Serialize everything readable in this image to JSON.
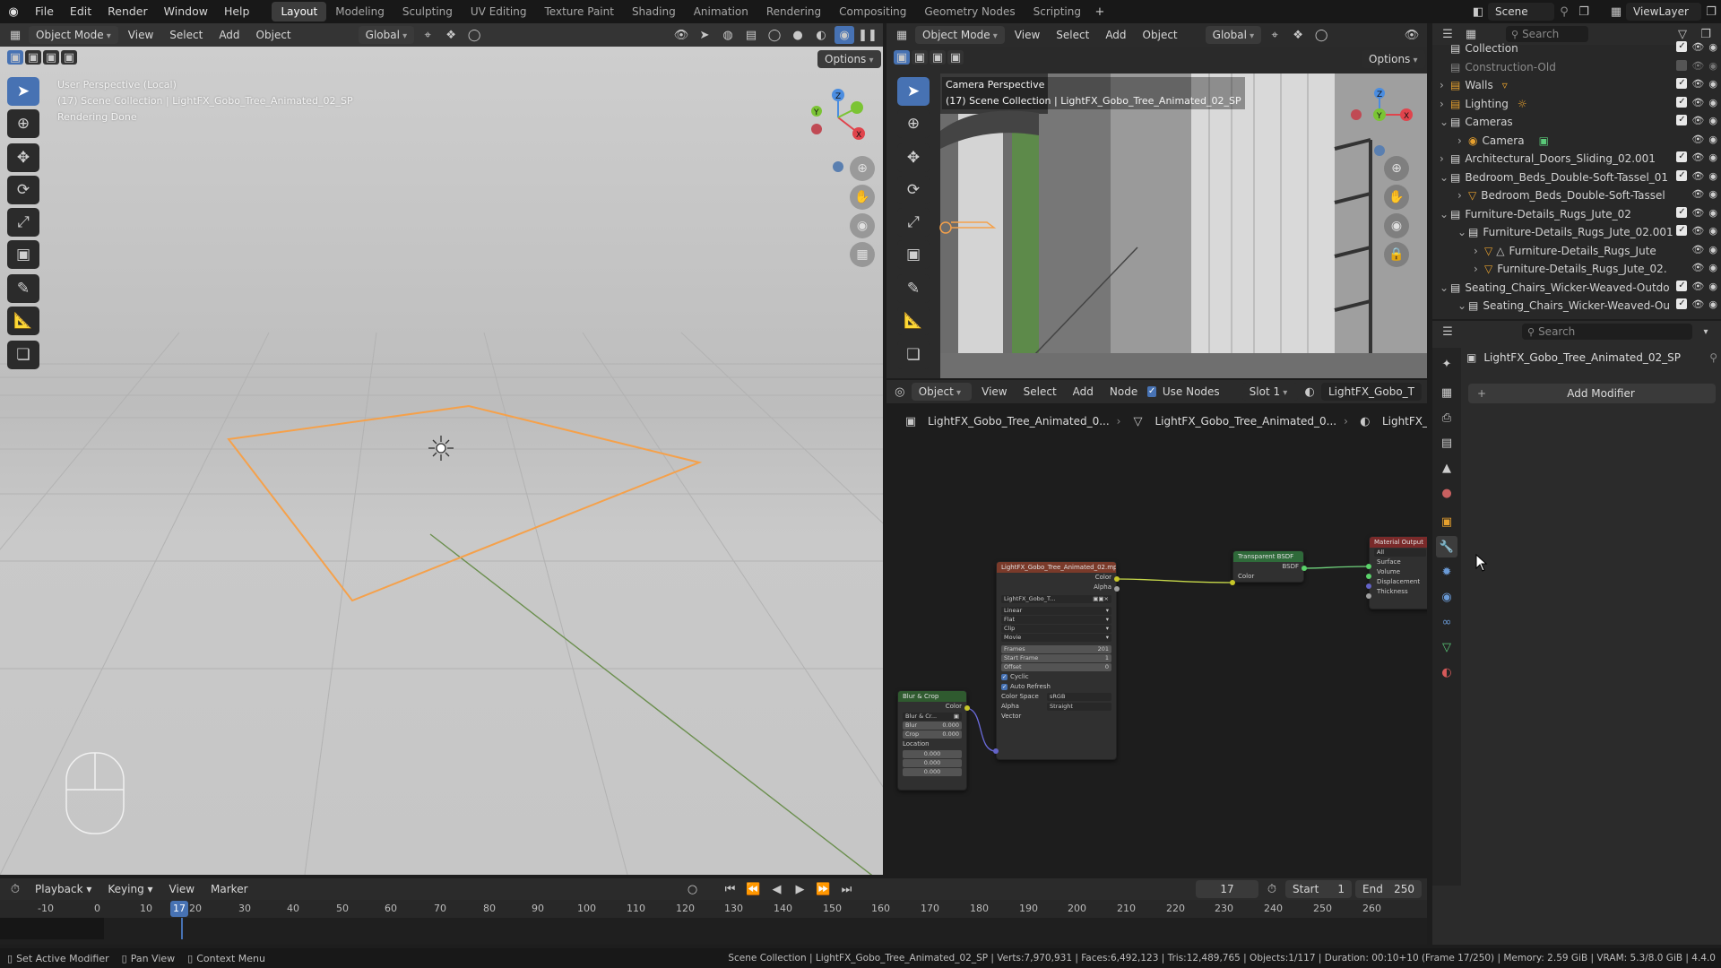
{
  "menu": {
    "items": [
      "File",
      "Edit",
      "Render",
      "Window",
      "Help"
    ]
  },
  "workspaces": [
    "Layout",
    "Modeling",
    "Sculpting",
    "UV Editing",
    "Texture Paint",
    "Shading",
    "Animation",
    "Rendering",
    "Compositing",
    "Geometry Nodes",
    "Scripting"
  ],
  "active_workspace": "Layout",
  "scene": {
    "name": "Scene",
    "viewlayer": "ViewLayer"
  },
  "vp1": {
    "mode": "Object Mode",
    "menus": [
      "View",
      "Select",
      "Add",
      "Object"
    ],
    "orientation": "Global",
    "options": "Options",
    "overlay": [
      "User Perspective (Local)",
      "(17) Scene Collection | LightFX_Gobo_Tree_Animated_02_SP",
      "Rendering Done"
    ]
  },
  "vp2": {
    "mode": "Object Mode",
    "menus": [
      "View",
      "Select",
      "Add",
      "Object"
    ],
    "orientation": "Global",
    "options": "Options",
    "overlay": [
      "Camera Perspective",
      "(17) Scene Collection | LightFX_Gobo_Tree_Animated_02_SP"
    ]
  },
  "nodeeditor": {
    "type": "Object",
    "menus": [
      "View",
      "Select",
      "Add",
      "Node"
    ],
    "use_nodes": "Use Nodes",
    "slot": "Slot 1",
    "material": "LightFX_Gobo_T",
    "breadcrumb": [
      "LightFX_Gobo_Tree_Animated_0...",
      "LightFX_Gobo_Tree_Animated_0...",
      "LightFX_Gobo_Tree..."
    ]
  },
  "nodes": {
    "image": {
      "title": "LightFX_Gobo_Tree_Animated_02.mp4",
      "out_color": "Color",
      "out_alpha": "Alpha",
      "img": "LightFX_Gobo_T...",
      "interp": "Linear",
      "proj": "Flat",
      "ext": "Clip",
      "source": "Movie",
      "frames_l": "Frames",
      "frames_v": "201",
      "start_l": "Start Frame",
      "start_v": "1",
      "offset_l": "Offset",
      "offset_v": "0",
      "cyclic": "Cyclic",
      "auto": "Auto Refresh",
      "cs_l": "Color Space",
      "cs_v": "sRGB",
      "alpha_l": "Alpha",
      "alpha_v": "Straight",
      "vector": "Vector"
    },
    "blur": {
      "title": "Blur & Crop",
      "out": "Color",
      "sub": "Blur & Cr...",
      "blur_l": "Blur",
      "blur_v": "0.000",
      "crop_l": "Crop",
      "crop_v": "0.000",
      "loc": "Location",
      "l1": "0.000",
      "l2": "0.000",
      "l3": "0.000"
    },
    "bsdf": {
      "title": "Transparent BSDF",
      "out": "BSDF",
      "in": "Color"
    },
    "output": {
      "title": "Material Output",
      "target": "All",
      "surface": "Surface",
      "volume": "Volume",
      "displacement": "Displacement",
      "thickness": "Thickness"
    }
  },
  "outliner": {
    "search": "Search",
    "rows": [
      {
        "name": "Collection",
        "indent": 0,
        "arrow": "",
        "dim": false
      },
      {
        "name": "Construction-Old",
        "indent": 0,
        "arrow": "",
        "dim": true
      },
      {
        "name": "Walls",
        "indent": 0,
        "arrow": "›",
        "dim": false
      },
      {
        "name": "Lighting",
        "indent": 0,
        "arrow": "›",
        "dim": false
      },
      {
        "name": "Cameras",
        "indent": 0,
        "arrow": "⌄",
        "dim": false
      },
      {
        "name": "Camera",
        "indent": 1,
        "arrow": "›",
        "dim": false
      },
      {
        "name": "Architectural_Doors_Sliding_02.001",
        "indent": 0,
        "arrow": "›",
        "dim": false
      },
      {
        "name": "Bedroom_Beds_Double-Soft-Tassel_01",
        "indent": 0,
        "arrow": "⌄",
        "dim": false
      },
      {
        "name": "Bedroom_Beds_Double-Soft-Tassel",
        "indent": 1,
        "arrow": "›",
        "dim": false
      },
      {
        "name": "Furniture-Details_Rugs_Jute_02",
        "indent": 0,
        "arrow": "⌄",
        "dim": false
      },
      {
        "name": "Furniture-Details_Rugs_Jute_02.001",
        "indent": 1,
        "arrow": "⌄",
        "dim": false
      },
      {
        "name": "Furniture-Details_Rugs_Jute",
        "indent": 2,
        "arrow": "›",
        "dim": false
      },
      {
        "name": "Furniture-Details_Rugs_Jute_02.",
        "indent": 2,
        "arrow": "›",
        "dim": false
      },
      {
        "name": "Seating_Chairs_Wicker-Weaved-Outdo",
        "indent": 0,
        "arrow": "⌄",
        "dim": false
      },
      {
        "name": "Seating_Chairs_Wicker-Weaved-Ou",
        "indent": 1,
        "arrow": "⌄",
        "dim": false
      }
    ]
  },
  "properties": {
    "search": "Search",
    "object": "LightFX_Gobo_Tree_Animated_02_SP",
    "add_modifier": "Add Modifier"
  },
  "timeline": {
    "menus": [
      "Playback",
      "Keying",
      "View",
      "Marker"
    ],
    "current": "17",
    "start_l": "Start",
    "start_v": "1",
    "end_l": "End",
    "end_v": "250",
    "ticks": [
      "-10",
      "0",
      "10",
      "20",
      "30",
      "40",
      "50",
      "60",
      "70",
      "80",
      "90",
      "100",
      "110",
      "120",
      "130",
      "140",
      "150",
      "160",
      "170",
      "180",
      "190",
      "200",
      "210",
      "220",
      "230",
      "240",
      "250",
      "260"
    ]
  },
  "status": {
    "left": [
      "Set Active Modifier",
      "Pan View",
      "Context Menu"
    ],
    "right": "Scene Collection | LightFX_Gobo_Tree_Animated_02_SP | Verts:7,970,931 | Faces:6,492,123 | Tris:12,489,765 | Objects:1/117 | Duration: 00:10+10 (Frame 17/250) | Memory: 2.59 GiB | VRAM: 5.3/8.0 GiB | 4.4.0"
  },
  "colors": {
    "accent": "#4772b3",
    "selected": "#f5a14b",
    "x_axis": "#e0444c",
    "y_axis": "#7bc434",
    "z_axis": "#4b8de0"
  }
}
